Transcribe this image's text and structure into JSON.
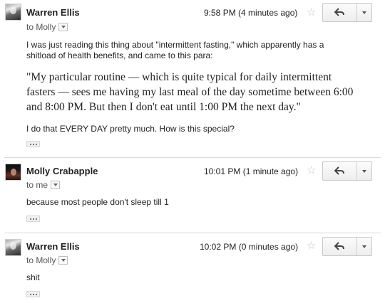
{
  "messages": [
    {
      "sender": "Warren Ellis",
      "recipient": "to Molly",
      "timestamp": "9:58 PM (4 minutes ago)",
      "avatar_icon": "person-photo-icon",
      "body_paragraphs": [
        "I was just reading this thing about \"intermittent fasting,\" which apparently has a shitload of health benefits, and came to this para:",
        "I do that EVERY DAY pretty much.  How is this special?"
      ],
      "quote": "\"My particular routine — which is quite typical for daily intermittent fasters — sees me having my last meal of the day sometime between 6:00 and 8:00 PM. But then I don't eat until 1:00 PM the next day.\""
    },
    {
      "sender": "Molly Crabapple",
      "recipient": "to me",
      "timestamp": "10:01 PM (1 minute ago)",
      "avatar_icon": "person-photo-icon",
      "body_paragraphs": [
        "because most people don't sleep till 1"
      ]
    },
    {
      "sender": "Warren Ellis",
      "recipient": "to Molly",
      "timestamp": "10:02 PM (0 minutes ago)",
      "avatar_icon": "person-photo-icon",
      "body_paragraphs": [
        "shit"
      ]
    }
  ],
  "icons": {
    "star": "star-icon",
    "reply": "reply-arrow-icon",
    "more": "chevron-down-icon",
    "recipient_details": "chevron-down-icon",
    "trimmed_content": "ellipsis-icon"
  },
  "colors": {
    "text": "#222222",
    "secondary_text": "#555555",
    "star": "#c6c6c6",
    "divider": "#dadada",
    "button_border": "#c8c8c8"
  }
}
